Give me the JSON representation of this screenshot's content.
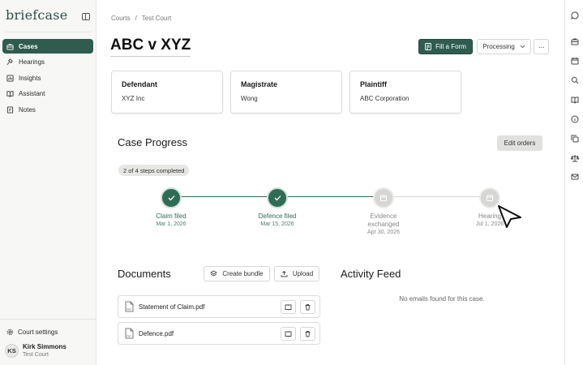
{
  "app": {
    "logo": "briefcase"
  },
  "sidebar": {
    "items": [
      {
        "label": "Cases",
        "icon": "briefcase-icon",
        "active": true
      },
      {
        "label": "Hearings",
        "icon": "gavel-icon",
        "active": false
      },
      {
        "label": "Insights",
        "icon": "chart-icon",
        "active": false
      },
      {
        "label": "Assistant",
        "icon": "book-icon",
        "active": false
      },
      {
        "label": "Notes",
        "icon": "note-icon",
        "active": false
      }
    ],
    "settings_label": "Court settings",
    "user": {
      "initials": "KS",
      "name": "Kirk Simmons",
      "court": "Test Court"
    }
  },
  "breadcrumb": {
    "root": "Courts",
    "separator": "/",
    "current": "Test Court"
  },
  "case": {
    "title": "ABC v XYZ",
    "fill_form_label": "Fill a Form",
    "status_label": "Processing",
    "more_label": "···"
  },
  "parties": [
    {
      "label": "Defendant",
      "value": "XYZ Inc"
    },
    {
      "label": "Magistrate",
      "value": "Wong"
    },
    {
      "label": "Plaintiff",
      "value": "ABC Corporation"
    }
  ],
  "progress": {
    "title": "Case Progress",
    "edit_label": "Edit orders",
    "badge": "2 of 4 steps completed",
    "completed": 2,
    "total": 4,
    "steps": [
      {
        "label": "Claim filed",
        "date": "Mar 1, 2026",
        "done": true
      },
      {
        "label": "Defence filed",
        "date": "Mar 15, 2026",
        "done": true
      },
      {
        "label": "Evidence exchanged",
        "date": "Apr 30, 2026",
        "done": false
      },
      {
        "label": "Hearing",
        "date": "Jul 1, 2026",
        "done": false
      }
    ]
  },
  "documents": {
    "title": "Documents",
    "create_bundle_label": "Create bundle",
    "upload_label": "Upload",
    "files": [
      {
        "name": "Statement of Claim.pdf"
      },
      {
        "name": "Defence.pdf"
      }
    ]
  },
  "activity": {
    "title": "Activity Feed",
    "empty_message": "No emails found for this case."
  },
  "colors": {
    "brand": "#2f5c4f",
    "done": "#2f6b55",
    "pending": "#d6d6d4"
  }
}
